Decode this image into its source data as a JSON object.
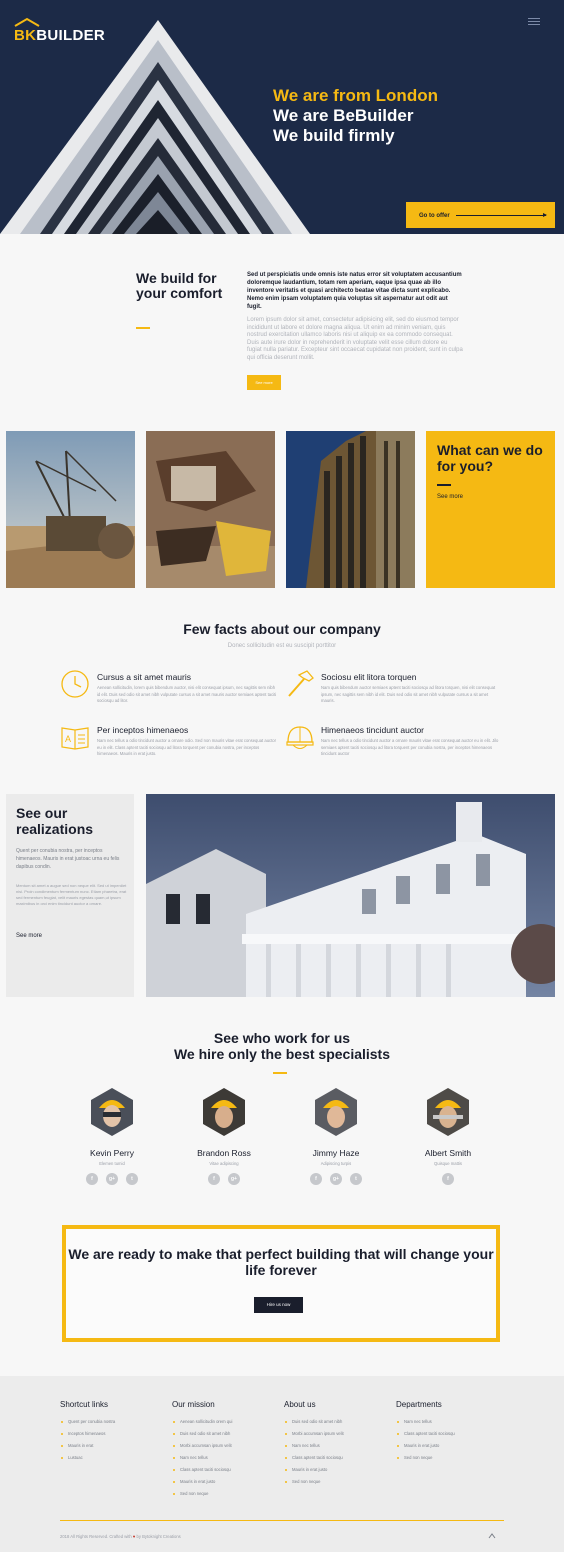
{
  "brand": {
    "logo_mark": "BK",
    "logo_word": "BUILDER",
    "accent": "#f5b913",
    "navy": "#1c2a47"
  },
  "hero": {
    "line1": "We are from London",
    "line2": "We are BeBuilder",
    "line3": "We build firmly",
    "cta": "Go to offer"
  },
  "intro": {
    "title": "We build for your comfort",
    "bold_text": "Sed ut perspiciatis unde omnis iste natus error sit voluptatem accusantium doloremque laudantium, totam rem aperiam, eaque ipsa quae ab illo inventore veritatis et quasi architecto beatae vitae dicta sunt explicabo. Nemo enim ipsam voluptatem quia voluptas sit aspernatur aut odit aut fugit.",
    "light_text": "Lorem ipsum dolor sit amet, consectetur adipisicing elit, sed do eiusmod tempor incididunt ut labore et dolore magna aliqua. Ut enim ad minim veniam, quis nostrud exercitation ullamco laboris nisi ut aliquip ex ea commodo consequat. Duis aute irure dolor in reprehenderit in voluptate velit esse cillum dolore eu fugiat nulla pariatur. Excepteur sint occaecat cupidatat non proident, sunt in culpa qui officia deserunt mollit.",
    "button": "See more"
  },
  "services": {
    "title": "What can we do for you?",
    "link": "See more"
  },
  "facts": {
    "title": "Few facts about our company",
    "subtitle": "Donec sollicitudin est eu suscipit porttitor",
    "items": [
      {
        "icon": "clock-icon",
        "title": "Cursus a sit amet mauris",
        "text": "Aenean sollicitudin, lorem quis bibendum auctor, nisi elit consequat ipsum, nec sagittis sem nibh id elit. Duis sed odio sit amet nibh vulputate cursus a sit amet mauris auctor semiaes aptent taciti sociosqu ad litor."
      },
      {
        "icon": "hammer-icon",
        "title": "Sociosu elit litora torquen",
        "text": "Nam quis bibendum auctor semiaes aptent taciti sociosqu ad litora torquen, nisi elit consequat ipsum, nec sagittis sem nibh id elit. Duis sed odio sit amet nibh vulputate cursus a sit amet mauris."
      },
      {
        "icon": "book-icon",
        "title": "Per inceptos himenaeos",
        "text": "Nam nec tellus a odio tincidunt auctor a ornare odio. Sed non mauris vitae erat consequat auctor eu in elit. Class aptent taciti sociosqu ad litora torquent per conubia nostra, per inceptos himenaeos. Mauris in erat justo."
      },
      {
        "icon": "helmet-icon",
        "title": "Himenaeos tincidunt auctor",
        "text": "Nam nec tellus a odio tincidunt auctor a ornare mauris vitae erat consequat auctor eu in elit. Jilo semiaes aptent taciti sociosqu ad litora torquent per conubia nostra, per inceptos himenaeos tincidunt auctor"
      }
    ]
  },
  "realizations": {
    "title": "See our realizations",
    "text1": "Quent per conubia nostra, per inceptos himenaeos. Mauris in erat justoac urna eu felis dapibus condin.",
    "text2": "Mentum sit amet a augue sed non neque elit. Sed ut imperdiet nisi. Proin condimentum fermentum nunc. Etiam pharetra, erat sed fermentum feugiat, velit mauris egestas quam,ut ipsum maximibus in orci enim tincidunt auctor a ornare.",
    "link": "See more"
  },
  "team": {
    "title1": "See who work for us",
    "title2": "We hire only the best specialists",
    "members": [
      {
        "name": "Kevin Perry",
        "role": "Elemen tumid",
        "socials": [
          "f",
          "g+",
          "t"
        ]
      },
      {
        "name": "Brandon Ross",
        "role": "Vitae adipiscing",
        "socials": [
          "f",
          "g+"
        ]
      },
      {
        "name": "Jimmy Haze",
        "role": "Adipiscing turpis",
        "socials": [
          "f",
          "g+",
          "t"
        ]
      },
      {
        "name": "Albert Smith",
        "role": "Quisque mattis",
        "socials": [
          "f"
        ]
      }
    ]
  },
  "cta": {
    "title": "We are ready to make that perfect building that will change your life forever",
    "button": "Hire us now"
  },
  "footer": {
    "columns": [
      {
        "title": "Shortcut links",
        "items": [
          "Quent per conubia nostra",
          "Inceptos himenaeos",
          "Mauris in erat",
          "Lustuac"
        ]
      },
      {
        "title": "Our mission",
        "items": [
          "Aenean sollicitudin orem qui",
          "Duis sed odio sit amet nibh",
          "Morbi accumsan ipsum velit",
          "Nam nec tellus",
          "Class aptent taciti sociosqu",
          "Mauris in erat justo",
          "Sed non neque"
        ]
      },
      {
        "title": "About us",
        "items": [
          "Duis sed odio sit amet nibh",
          "Morbi accumsan ipsum velit",
          "Nam nec tellus",
          "Class aptent taciti sociosqu",
          "Mauris in erat justo",
          "Sed non neque"
        ]
      },
      {
        "title": "Departments",
        "items": [
          "Nam nec tellus",
          "Class aptent taciti sociosqu",
          "Mauris in erat justo",
          "Sed non neque"
        ]
      }
    ],
    "copyright_pre": "2018 All Rights Reserved. Crafted with",
    "copyright_post": "by Bytoknight Creations"
  }
}
